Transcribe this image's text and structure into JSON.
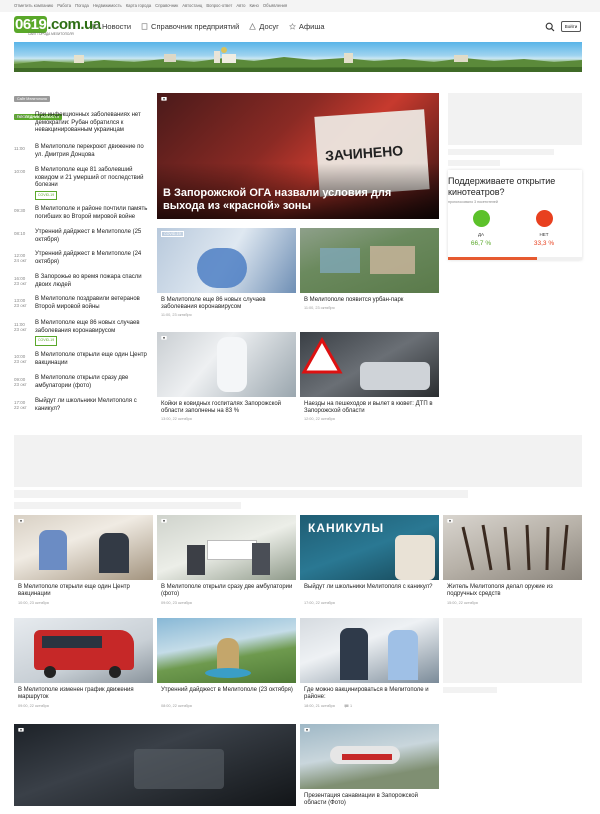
{
  "topbar": {
    "links": [
      "Отметить компанию",
      "Работа",
      "Погода",
      "Недвижимость",
      "Карта города",
      "Справочник",
      "Автостанц",
      "Вопрос-ответ",
      "Авто",
      "Кино",
      "Объявления"
    ]
  },
  "header": {
    "logo_prefix": "0619",
    "logo_suffix": ".com.ua",
    "logo_tagline": "САЙТ ГОРОДА МЕЛИТОПОЛЯ",
    "nav": [
      {
        "label": "Новости",
        "icon": "chat-icon"
      },
      {
        "label": "Справочник предприятий",
        "icon": "book-icon"
      },
      {
        "label": "Досуг",
        "icon": "tent-icon"
      },
      {
        "label": "Афиша",
        "icon": "star-icon"
      }
    ],
    "login_label": "Войти"
  },
  "sidebar": {
    "tag_city": "Сайт Мелитополя",
    "tag_last": "ПОСЛЕДНИЕ НОВОСТИ",
    "items": [
      {
        "time": "13:00",
        "title": "При инфекционных заболеваниях нет демократии: Рубан обратился к невакцинированным украинцам",
        "badge": ""
      },
      {
        "time": "11:00",
        "title": "В Мелитополе перекроют движение по ул. Дмитрия Донцова",
        "badge": ""
      },
      {
        "time": "10:00",
        "title": "В Мелитополе еще 81 заболевший ковидом и 21 умерший от последствий болезни",
        "badge": "COVID-19"
      },
      {
        "time": "09:30",
        "title": "В Мелитополе и районе почтили память погибших во Второй мировой войне",
        "badge": ""
      },
      {
        "time": "08:10",
        "title": "Утренний дайджест в Мелитополе (25 октября)",
        "badge": ""
      },
      {
        "time": "12:00 24 окт",
        "title": "Утренний дайджест в Мелитополе (24 октября)",
        "badge": ""
      },
      {
        "time": "16:00 23 окт",
        "title": "В Запорожье во время пожара спасли двоих людей",
        "badge": ""
      },
      {
        "time": "13:00 23 окт",
        "title": "В Мелитополе поздравили ветеранов Второй мировой войны",
        "badge": ""
      },
      {
        "time": "11:00 23 окт",
        "title": "В Мелитополе еще 86 новых случаев заболевания коронавирусом",
        "badge": "COVID-19"
      },
      {
        "time": "10:00 23 окт",
        "title": "В Мелитополе открыли еще один Центр вакцинации",
        "badge": ""
      },
      {
        "time": "09:00 23 окт",
        "title": "В Мелитополе открыли сразу две амбулатории (фото)",
        "badge": ""
      },
      {
        "time": "17:00 22 окт",
        "title": "Выйдут ли школьники Мелитополя с каникул?",
        "badge": ""
      }
    ]
  },
  "hero": {
    "title": "В Запорожской ОГА назвали условия для выхода из «красной» зоны",
    "sign_text": "ЗАЧИНЕНО"
  },
  "grid_top": [
    {
      "title": "В Мелитополе еще 86 новых случаев заболевания коронавирусом",
      "date": "11:00, 23 октября",
      "badge": "COVID-19"
    },
    {
      "title": "В Мелитополе появится урбан-парк",
      "date": "11:00, 23 октября",
      "badge": ""
    },
    {
      "title": "Койки в ковидных госпиталях Запорожской области заполнены на 83 %",
      "date": "13:00, 22 октября",
      "badge": ""
    },
    {
      "title": "Наезды на пешеходов и вылет в кювет: ДТП в Запорожской области",
      "date": "12:00, 22 октября",
      "badge": ""
    }
  ],
  "poll": {
    "question": "Поддерживаете открытие кинотеатров?",
    "subtitle": "проголосовало 3 посетителей",
    "yes_label": "ДА",
    "no_label": "НЕТ",
    "yes_pct": "66,7 %",
    "no_pct": "33,3 %",
    "yes_fraction": 0.667,
    "colors": {
      "yes": "#5cc12a",
      "no": "#e8401f"
    }
  },
  "grid_bottom": [
    {
      "title": "В Мелитополе открыли еще один Центр вакцинации",
      "date": "10:00, 23 октября",
      "comments": ""
    },
    {
      "title": "В Мелитополе открыли сразу две амбулатории (фото)",
      "date": "09:00, 23 октября",
      "comments": ""
    },
    {
      "title": "Выйдут ли школьники Мелитополя с каникул?",
      "date": "17:00, 22 октября",
      "comments": "",
      "image_text": "КАНИКУЛЫ"
    },
    {
      "title": "Житель Мелитополя делал оружие из подручных средств",
      "date": "15:00, 22 октября",
      "comments": ""
    },
    {
      "title": "В Мелитополе изменен график движения маршруток",
      "date": "09:00, 22 октября",
      "comments": ""
    },
    {
      "title": "Утренний дайджест в Мелитополе (23 октября)",
      "date": "08:00, 22 октября",
      "comments": ""
    },
    {
      "title": "Где можно вакцинироваться в Мелитополе и районе:",
      "date": "18:00, 21 октября",
      "comments": "1"
    },
    {
      "title": "Презентация санавиации в Запорожской области (Фото)",
      "date": "",
      "comments": ""
    }
  ],
  "colors": {
    "brand_green": "#5aa82a",
    "dark_green": "#2d6e14",
    "accent_red": "#e8401f"
  }
}
